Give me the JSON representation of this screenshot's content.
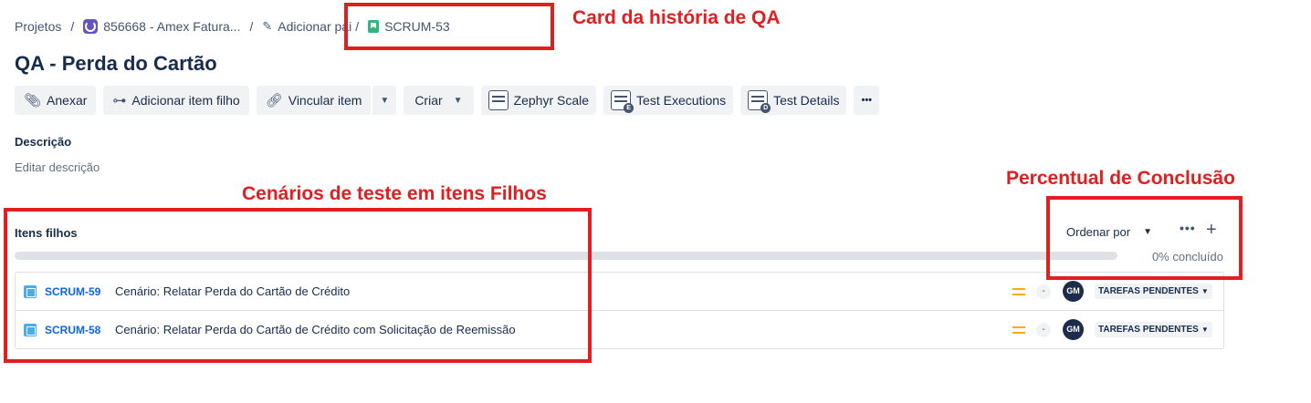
{
  "breadcrumb": {
    "root": "Projetos",
    "project": "856668 - Amex Fatura...",
    "parent": "Adicionar pai",
    "current": "SCRUM-53"
  },
  "title": "QA - Perda do Cartão",
  "toolbar": {
    "attach": "Anexar",
    "add_child": "Adicionar item filho",
    "link": "Vincular item",
    "create": "Criar",
    "zephyr": "Zephyr Scale",
    "test_exec": "Test Executions",
    "test_details": "Test Details",
    "more": "•••"
  },
  "description": {
    "label": "Descrição",
    "placeholder": "Editar descrição"
  },
  "children": {
    "label": "Itens filhos",
    "sort_label": "Ordenar por",
    "more": "•••",
    "add": "+",
    "progress_text": "0% concluído",
    "progress_fraction": 0,
    "items": [
      {
        "key": "SCRUM-59",
        "summary": "Cenário: Relatar Perda do Cartão de Crédito",
        "estimate": "-",
        "assignee": "GM",
        "status": "TAREFAS PENDENTES"
      },
      {
        "key": "SCRUM-58",
        "summary": "Cenário: Relatar Perda do Cartão de Crédito com Solicitação de Reemissão",
        "estimate": "-",
        "assignee": "GM",
        "status": "TAREFAS PENDENTES"
      }
    ]
  },
  "annotations": {
    "card": "Card da história de QA",
    "scenarios": "Cenários de teste em itens Filhos",
    "percent": "Percentual de Conclusão"
  },
  "colors": {
    "annotation": "#e02020",
    "link": "#0c66e4",
    "priority": "#ffab00",
    "story": "#36b37e",
    "task": "#4bade8"
  }
}
